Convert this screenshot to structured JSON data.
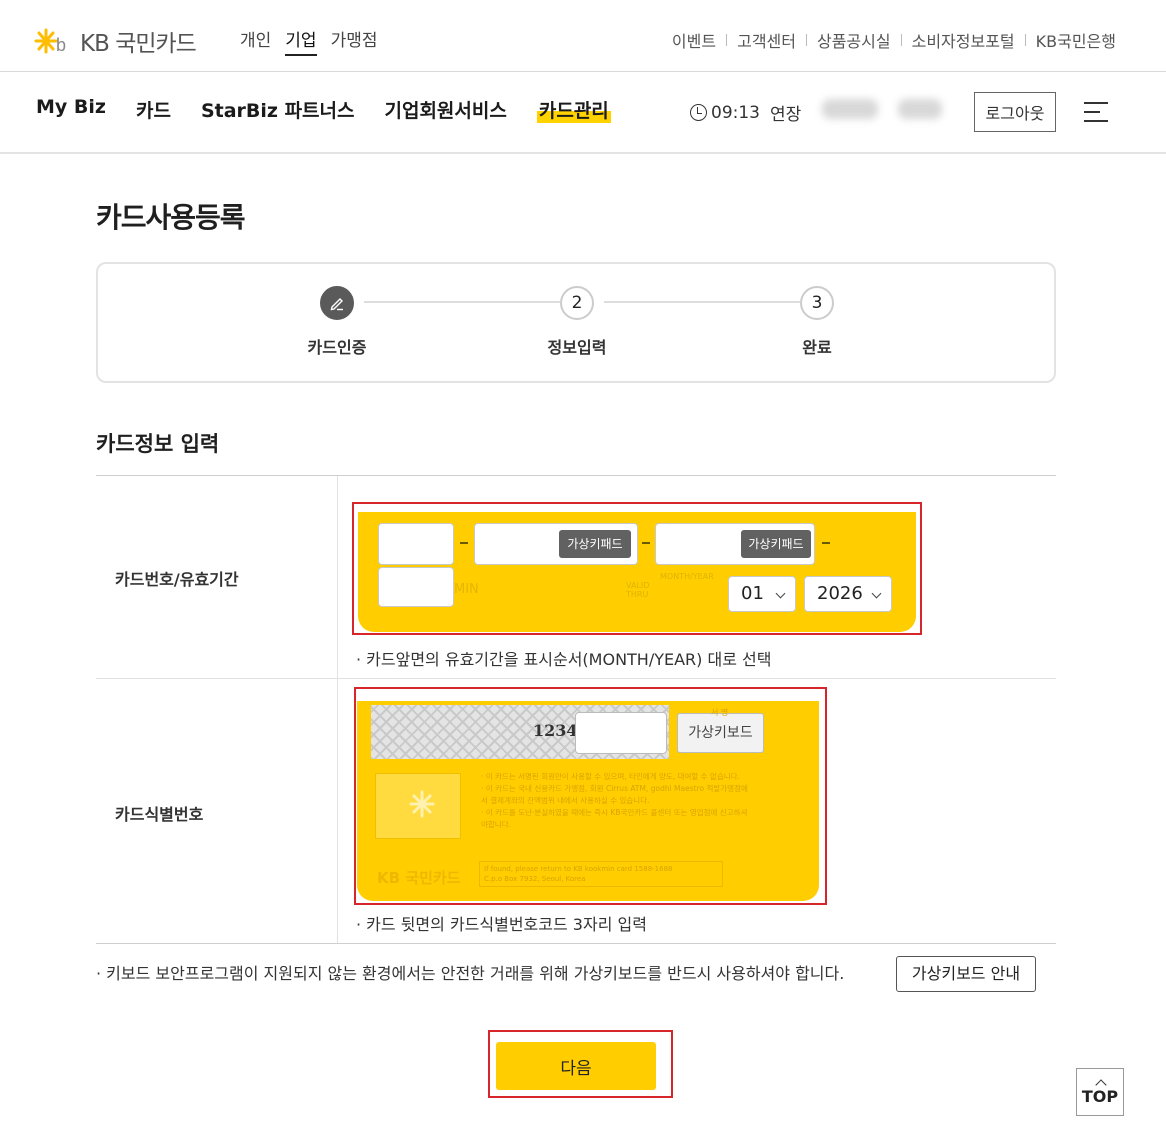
{
  "header": {
    "logo_text": "국민카드",
    "segments": [
      "개인",
      "기업",
      "가맹점"
    ],
    "active_segment": "기업",
    "util_links": [
      "이벤트",
      "고객센터",
      "상품공시실",
      "소비자정보포털",
      "KB국민은행"
    ]
  },
  "gnb": {
    "menu": [
      "My Biz",
      "카드",
      "StarBiz 파트너스",
      "기업회원서비스",
      "카드관리"
    ],
    "active_menu": "카드관리",
    "timer": "09:13",
    "extend_label": "연장",
    "logout_label": "로그아웃"
  },
  "page": {
    "title": "카드사용등록"
  },
  "steps": [
    {
      "num": "",
      "label": "카드인증",
      "state": "done"
    },
    {
      "num": "2",
      "label": "정보입력",
      "state": "todo"
    },
    {
      "num": "3",
      "label": "완료",
      "state": "todo"
    }
  ],
  "section": {
    "title": "카드정보 입력"
  },
  "card_number": {
    "label": "카드번호/유효기간",
    "vk_label_1": "가상키패드",
    "vk_label_2": "가상키패드",
    "month": "01",
    "year": "2026",
    "ghost_min": "MIN",
    "ghost_valid": "VALID\nTHRU",
    "ghost_monthyear": "MONTH/YEAR",
    "note": "· 카드앞면의 유효기간을 표시순서(MONTH/YEAR) 대로 선택"
  },
  "card_id": {
    "label": "카드식별번호",
    "last4": "1234",
    "vk_label": "가상키보드",
    "note": "· 카드 뒷면의 카드식별번호코드 3자리 입력"
  },
  "footer_note": "· 키보드 보안프로그램이 지원되지 않는 환경에서는 안전한 거래를 위해 가상키보드를 반드시 사용하셔야 합니다.",
  "vk_guide_label": "가상키보드 안내",
  "next_label": "다음",
  "top_label": "TOP",
  "colors": {
    "brand_yellow": "#ffcd00",
    "highlight_red": "#d6262b"
  }
}
